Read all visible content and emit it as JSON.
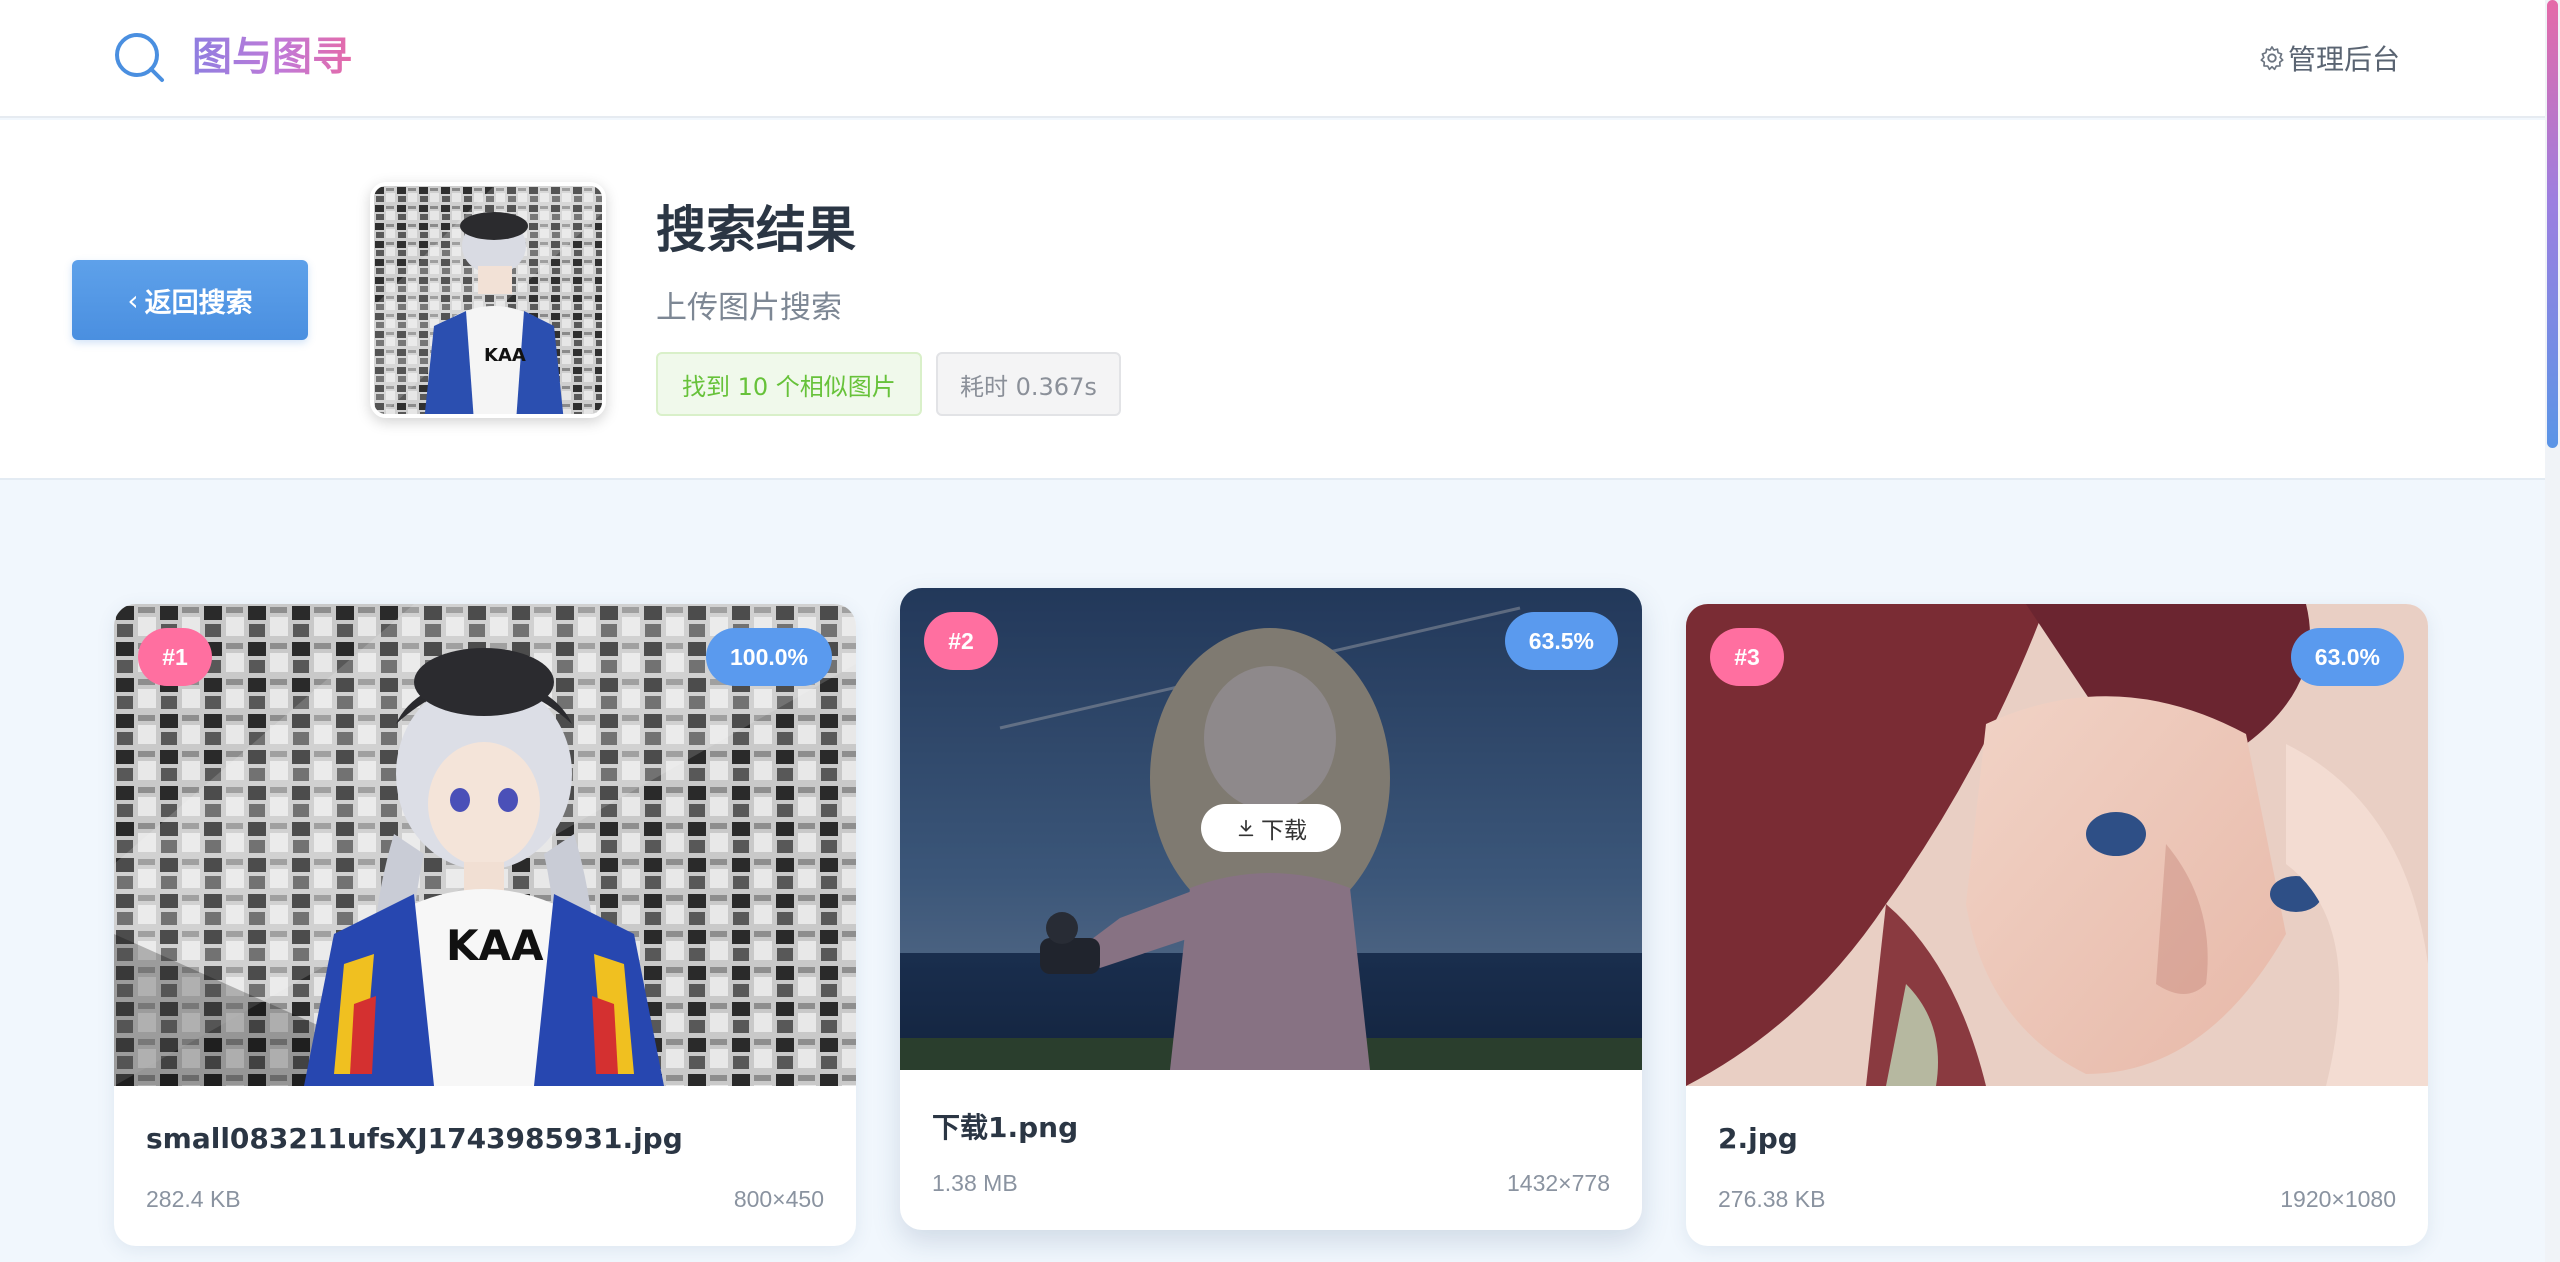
{
  "nav": {
    "logo_text": "图与图寻",
    "admin_label": "管理后台"
  },
  "header": {
    "back_label": "返回搜索",
    "title": "搜索结果",
    "subtitle": "上传图片搜索",
    "found_tag": "找到 10 个相似图片",
    "time_tag": "耗时 0.367s"
  },
  "results": [
    {
      "rank": "#1",
      "similarity": "100.0%",
      "filename": "small083211ufsXJ1743985931.jpg",
      "size": "282.4 KB",
      "dimensions": "800×450"
    },
    {
      "rank": "#2",
      "similarity": "63.5%",
      "filename": "下载1.png",
      "size": "1.38 MB",
      "dimensions": "1432×778",
      "download_label": "下载"
    },
    {
      "rank": "#3",
      "similarity": "63.0%",
      "filename": "2.jpg",
      "size": "276.38 KB",
      "dimensions": "1920×1080"
    }
  ],
  "colors": {
    "accent": "#4a8fe0",
    "rank_badge": "#ff6fa0",
    "similarity_badge": "#5a9aee",
    "found_tag_text": "#67c23a"
  }
}
